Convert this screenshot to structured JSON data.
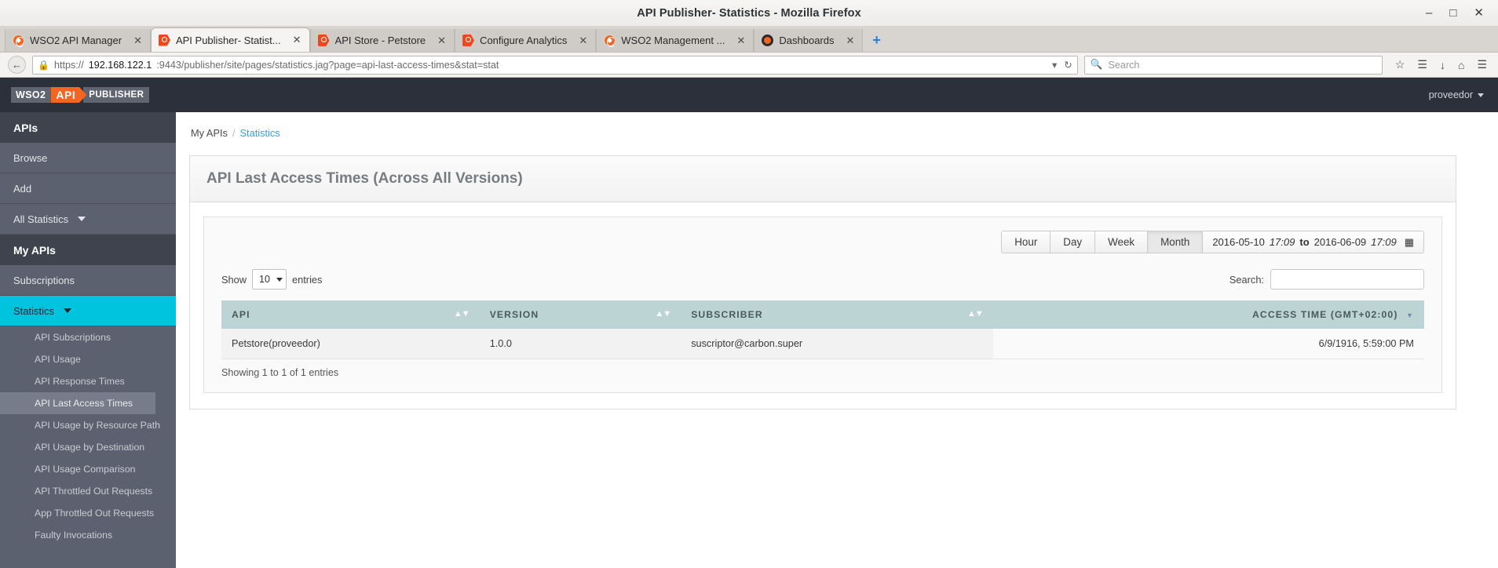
{
  "window": {
    "title": "API Publisher- Statistics - Mozilla Firefox",
    "minimize": "–",
    "maximize": "□",
    "close": "✕"
  },
  "tabs": [
    {
      "label": "WSO2 API Manager",
      "icon": "wso2-favicon",
      "close": "✕",
      "active": false
    },
    {
      "label": "API Publisher- Statist...",
      "icon": "api-publisher-favicon",
      "close": "✕",
      "active": true
    },
    {
      "label": "API Store - Petstore",
      "icon": "api-store-favicon",
      "close": "✕",
      "active": false
    },
    {
      "label": "Configure Analytics",
      "icon": "api-publisher-favicon",
      "close": "✕",
      "active": false
    },
    {
      "label": "WSO2 Management ...",
      "icon": "wso2-favicon",
      "close": "✕",
      "active": false
    },
    {
      "label": "Dashboards",
      "icon": "dashboards-favicon",
      "close": "✕",
      "active": false
    }
  ],
  "new_tab_label": "+",
  "navigation": {
    "back_glyph": "←",
    "lock_glyph": "🔒",
    "url_scheme": "https://",
    "url_host": "192.168.122.1",
    "url_rest": ":9443/publisher/site/pages/statistics.jag?page=api-last-access-times&stat=stat",
    "dropdown_glyph": "▾",
    "reload_glyph": "↻",
    "search_placeholder": "Search",
    "search_glyph": "🔍",
    "bookmark_glyph": "☆",
    "library_glyph": "☰",
    "download_glyph": "↓",
    "home_glyph": "⌂",
    "menu_glyph": "☰"
  },
  "topbar": {
    "logo_wso2": "WSO2",
    "logo_api": "API",
    "logo_publisher": "PUBLISHER",
    "user": "proveedor"
  },
  "sidebar": {
    "groups": [
      {
        "header": "APIs",
        "items": [
          {
            "label": "Browse",
            "active": false,
            "expandable": false
          },
          {
            "label": "Add",
            "active": false,
            "expandable": false
          },
          {
            "label": "All Statistics",
            "active": false,
            "expandable": true
          }
        ]
      },
      {
        "header": "My APIs",
        "items": [
          {
            "label": "Subscriptions",
            "active": false,
            "expandable": false
          },
          {
            "label": "Statistics",
            "active": true,
            "expandable": true
          }
        ]
      }
    ],
    "sub_items": [
      {
        "label": "API Subscriptions",
        "selected": false
      },
      {
        "label": "API Usage",
        "selected": false
      },
      {
        "label": "API Response Times",
        "selected": false
      },
      {
        "label": "API Last Access Times",
        "selected": true
      },
      {
        "label": "API Usage by Resource Path",
        "selected": false
      },
      {
        "label": "API Usage by Destination",
        "selected": false
      },
      {
        "label": "API Usage Comparison",
        "selected": false
      },
      {
        "label": "API Throttled Out Requests",
        "selected": false
      },
      {
        "label": "App Throttled Out Requests",
        "selected": false
      },
      {
        "label": "Faulty Invocations",
        "selected": false
      }
    ]
  },
  "breadcrumb": {
    "root": "My APIs",
    "separator": "/",
    "current": "Statistics"
  },
  "panel": {
    "title": "API Last Access Times (Across All Versions)"
  },
  "period_buttons": [
    {
      "label": "Hour",
      "active": false
    },
    {
      "label": "Day",
      "active": false
    },
    {
      "label": "Week",
      "active": false
    },
    {
      "label": "Month",
      "active": true
    }
  ],
  "date_range": {
    "from_date": "2016-05-10",
    "from_time": "17:09",
    "to_word": "to",
    "to_date": "2016-06-09",
    "to_time": "17:09",
    "calendar_glyph": "▦"
  },
  "table_controls": {
    "show_label": "Show",
    "entries_label": "entries",
    "page_length": "10",
    "search_label": "Search:",
    "search_value": "",
    "search_placeholder": ""
  },
  "table": {
    "columns": [
      {
        "label": "API",
        "align": "left",
        "sort": "both"
      },
      {
        "label": "VERSION",
        "align": "left",
        "sort": "both"
      },
      {
        "label": "SUBSCRIBER",
        "align": "left",
        "sort": "both"
      },
      {
        "label": "ACCESS TIME (GMT+02:00)",
        "align": "right",
        "sort": "desc"
      }
    ],
    "rows": [
      {
        "api": "Petstore(proveedor)",
        "version": "1.0.0",
        "subscriber": "suscriptor@carbon.super",
        "access_time": "6/9/1916, 5:59:00 PM"
      }
    ],
    "info": "Showing 1 to 1 of 1 entries"
  }
}
